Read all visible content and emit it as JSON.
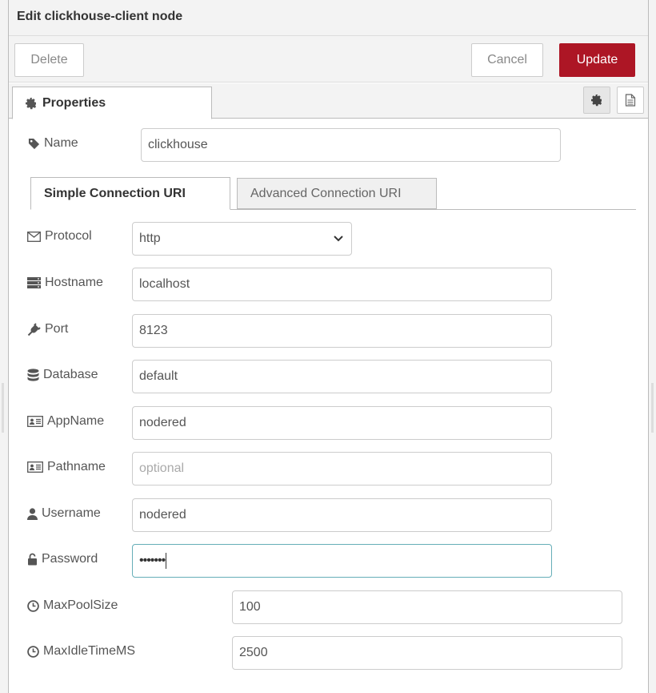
{
  "header": {
    "title": "Edit clickhouse-client node"
  },
  "toolbar": {
    "delete_label": "Delete",
    "cancel_label": "Cancel",
    "update_label": "Update",
    "update_color": "#ad1625"
  },
  "tabs": {
    "properties_label": "Properties"
  },
  "form": {
    "name": {
      "label": "Name",
      "value": "clickhouse"
    },
    "connection_tabs": {
      "simple": "Simple Connection URI",
      "advanced": "Advanced Connection URI"
    },
    "protocol": {
      "label": "Protocol",
      "value": "http"
    },
    "hostname": {
      "label": "Hostname",
      "value": "localhost"
    },
    "port": {
      "label": "Port",
      "value": "8123"
    },
    "database": {
      "label": "Database",
      "value": "default"
    },
    "appname": {
      "label": "AppName",
      "value": "nodered"
    },
    "pathname": {
      "label": "Pathname",
      "value": "",
      "placeholder": "optional"
    },
    "username": {
      "label": "Username",
      "value": "nodered"
    },
    "password": {
      "label": "Password",
      "value": "•••••••"
    },
    "maxpoolsize": {
      "label": "MaxPoolSize",
      "value": "100"
    },
    "maxidletime": {
      "label": "MaxIdleTimeMS",
      "value": "2500"
    }
  }
}
